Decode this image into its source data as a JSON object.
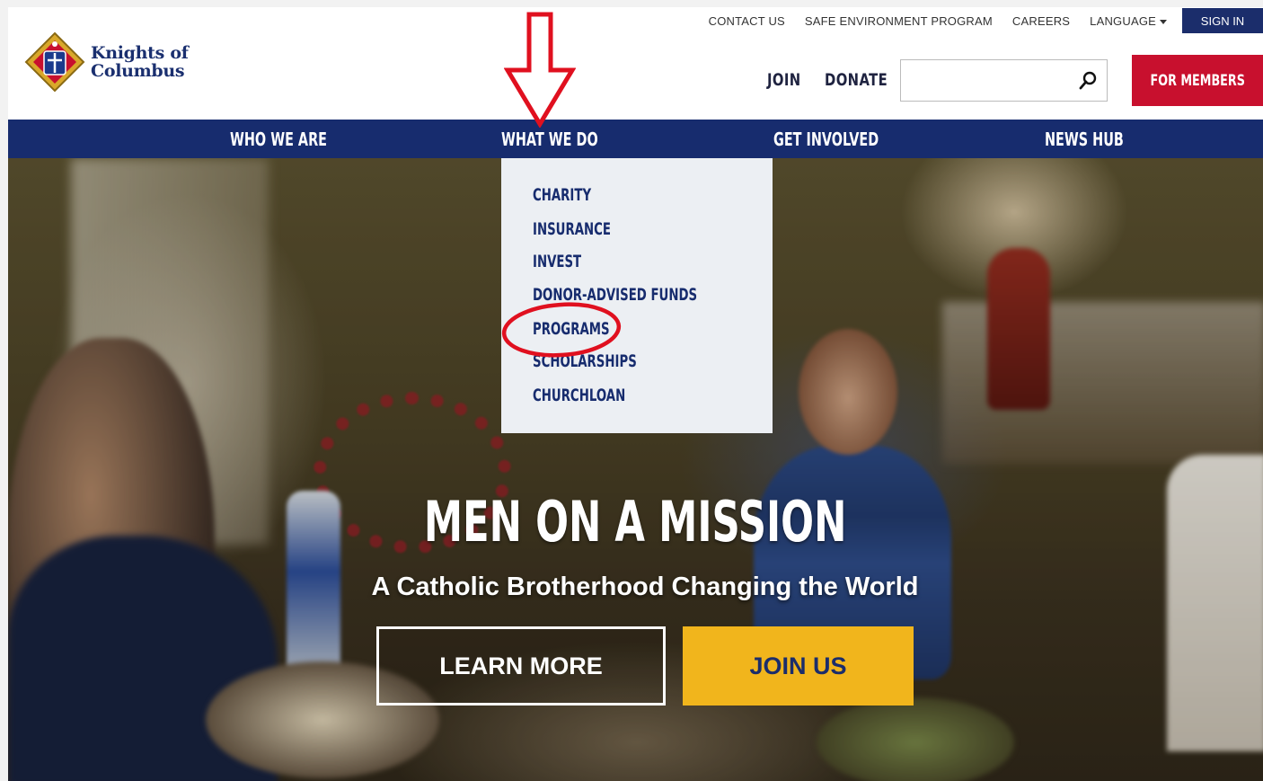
{
  "brand": {
    "name_line1": "Knights of",
    "name_line2": "Columbus",
    "logo_letters": "K of C"
  },
  "utility_nav": {
    "contact": "CONTACT US",
    "safe_env": "SAFE ENVIRONMENT PROGRAM",
    "careers": "CAREERS",
    "language": "LANGUAGE",
    "sign_in": "SIGN IN"
  },
  "header": {
    "join": "JOIN",
    "donate": "DONATE",
    "search": {
      "value": "",
      "placeholder": ""
    },
    "for_members": "FOR MEMBERS"
  },
  "main_nav": [
    "WHO WE ARE",
    "WHAT WE DO",
    "GET INVOLVED",
    "NEWS HUB"
  ],
  "dropdown": {
    "parent": "WHAT WE DO",
    "items": [
      "CHARITY",
      "INSURANCE",
      "INVEST",
      "DONOR-ADVISED FUNDS",
      "PROGRAMS",
      "SCHOLARSHIPS",
      "CHURCHLOAN"
    ],
    "highlighted": "PROGRAMS"
  },
  "hero": {
    "title": "MEN ON A MISSION",
    "subtitle": "A Catholic Brotherhood Changing the World",
    "learn_more": "LEARN MORE",
    "join_us": "JOIN US"
  },
  "colors": {
    "navy": "#172c6e",
    "red": "#c8102e",
    "gold": "#f1b51c",
    "annotation_red": "#e0101f"
  },
  "icons": [
    "search-icon",
    "caret-down-icon",
    "down-arrow-annotation",
    "circle-annotation"
  ]
}
